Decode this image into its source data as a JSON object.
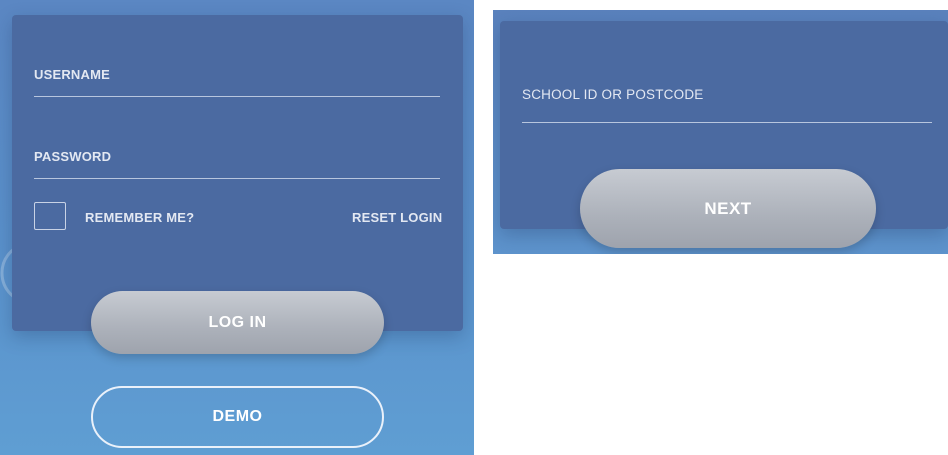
{
  "login": {
    "username_label": "USERNAME",
    "password_label": "PASSWORD",
    "remember_label": "REMEMBER ME?",
    "reset_label": "RESET LOGIN",
    "login_button": "LOG IN",
    "demo_button": "DEMO"
  },
  "school": {
    "field_label": "SCHOOL ID OR POSTCODE",
    "next_button": "NEXT"
  },
  "colors": {
    "card": "#4b6aa1",
    "background": "#5a91cb",
    "button_gray": "#acb1ba"
  }
}
